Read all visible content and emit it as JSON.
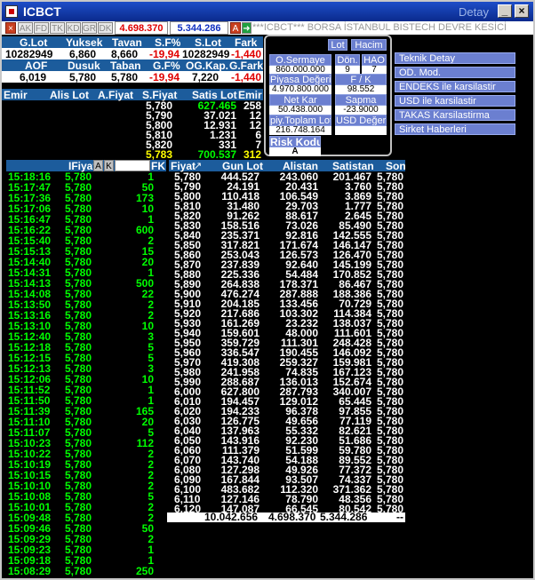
{
  "window": {
    "title": "ICBCT",
    "detay": "Detay"
  },
  "toolbar": {
    "buttons": [
      "AK",
      "FD",
      "TK",
      "KD",
      "GR",
      "DK"
    ],
    "price_red": "4.698.370",
    "price_blue": "5.344.286",
    "a_label": "A",
    "ticker": "***ICBCT*** BORSA İSTANBUL BISTECH DEVRE KESİCİ"
  },
  "stats": {
    "h1": [
      "G.Lot",
      "Yuksek",
      "Tavan",
      "S.F%",
      "S.Lot",
      "Fark"
    ],
    "r1": [
      "10282949",
      "6,860",
      "8,660",
      "-19,94",
      "10282949",
      "-1,440"
    ],
    "h2": [
      "AOF",
      "Dusuk",
      "Taban",
      "G.F%",
      "OG.Kap.",
      "G.Fark"
    ],
    "r2": [
      "6,019",
      "5,780",
      "5,780",
      "-19,94",
      "7,220",
      "-1,440"
    ]
  },
  "depth": {
    "headers": [
      "Emir",
      "Alis Lot",
      "A.Fiyat",
      "S.Fiyat",
      "Satis Lot",
      "Emir"
    ],
    "rows": [
      {
        "sf": "5,780",
        "sl": "627.465",
        "se": "258"
      },
      {
        "sf": "5,790",
        "sl": "37.021",
        "se": "12"
      },
      {
        "sf": "5,800",
        "sl": "12.931",
        "se": "12"
      },
      {
        "sf": "5,810",
        "sl": "1.231",
        "se": "6"
      },
      {
        "sf": "5,820",
        "sl": "331",
        "se": "7"
      },
      {
        "sf": "5,783",
        "sl": "700.537",
        "se": "312"
      }
    ]
  },
  "panel": {
    "lot": "Lot",
    "hacim": "Hacim",
    "osermaye": "O.Sermaye",
    "osermaye_val": "860.000.000",
    "don": "Dön.",
    "don_val": "9",
    "hao": "HAO",
    "hao_val": "7",
    "piyasa": "Piyasa Değeri",
    "piyasa_val": "4.970.800.000",
    "fk": "F / K",
    "fk_val": "98.552",
    "netkar": "Net Kar",
    "netkar_val": "50.438.000",
    "sapma": "Sapma",
    "sapma_val": "-23.9000",
    "piytoplam": "piy.Toplam Lot",
    "piytoplam_val": "216.748.164",
    "usd": "USD Değeri",
    "risk": "Risk Kodu",
    "risk_val": "A"
  },
  "menu": [
    "Teknik Detay",
    "OD. Mod.",
    "ENDEKS ile karsilastir",
    "USD ile karsilastir",
    "TAKAS Karsilastirma",
    "Sirket Haberleri"
  ],
  "trades": {
    "headers": {
      "fiyat": "IFiyat",
      "a": "A",
      "k": "K",
      "fk": "FK"
    },
    "rows": [
      [
        "15:18:16",
        "5,780",
        "1"
      ],
      [
        "15:17:47",
        "5,780",
        "50"
      ],
      [
        "15:17:36",
        "5,780",
        "173"
      ],
      [
        "15:17:06",
        "5,780",
        "10"
      ],
      [
        "15:16:47",
        "5,780",
        "1"
      ],
      [
        "15:16:22",
        "5,780",
        "600"
      ],
      [
        "15:15:40",
        "5,780",
        "2"
      ],
      [
        "15:15:13",
        "5,780",
        "15"
      ],
      [
        "15:14:40",
        "5,780",
        "20"
      ],
      [
        "15:14:31",
        "5,780",
        "1"
      ],
      [
        "15:14:13",
        "5,780",
        "500"
      ],
      [
        "15:14:08",
        "5,780",
        "22"
      ],
      [
        "15:13:50",
        "5,780",
        "2"
      ],
      [
        "15:13:16",
        "5,780",
        "2"
      ],
      [
        "15:13:10",
        "5,780",
        "10"
      ],
      [
        "15:12:40",
        "5,780",
        "3"
      ],
      [
        "15:12:18",
        "5,780",
        "5"
      ],
      [
        "15:12:15",
        "5,780",
        "5"
      ],
      [
        "15:12:13",
        "5,780",
        "3"
      ],
      [
        "15:12:06",
        "5,780",
        "10"
      ],
      [
        "15:11:52",
        "5,780",
        "1"
      ],
      [
        "15:11:50",
        "5,780",
        "1"
      ],
      [
        "15:11:39",
        "5,780",
        "165"
      ],
      [
        "15:11:10",
        "5,780",
        "20"
      ],
      [
        "15:11:07",
        "5,780",
        "5"
      ],
      [
        "15:10:23",
        "5,780",
        "112"
      ],
      [
        "15:10:22",
        "5,780",
        "2"
      ],
      [
        "15:10:19",
        "5,780",
        "2"
      ],
      [
        "15:10:15",
        "5,780",
        "2"
      ],
      [
        "15:10:10",
        "5,780",
        "2"
      ],
      [
        "15:10:08",
        "5,780",
        "5"
      ],
      [
        "15:10:01",
        "5,780",
        "2"
      ],
      [
        "15:09:48",
        "5,780",
        "2"
      ],
      [
        "15:09:46",
        "5,780",
        "50"
      ],
      [
        "15:09:29",
        "5,780",
        "2"
      ],
      [
        "15:09:23",
        "5,780",
        "1"
      ],
      [
        "15:09:18",
        "5,780",
        "1"
      ],
      [
        "15:08:29",
        "5,780",
        "250"
      ]
    ]
  },
  "prices": {
    "headers": [
      "Fiyat",
      "Gun Lot",
      "Alistan",
      "Satistan",
      "Son"
    ],
    "sort_icon": "sort-arrow-icon",
    "rows": [
      [
        "5,780",
        "444.527",
        "243.060",
        "201.467",
        "5,780"
      ],
      [
        "5,790",
        "24.191",
        "20.431",
        "3.760",
        "5,780"
      ],
      [
        "5,800",
        "110.418",
        "106.549",
        "3.869",
        "5,780"
      ],
      [
        "5,810",
        "31.480",
        "29.703",
        "1.777",
        "5,780"
      ],
      [
        "5,820",
        "91.262",
        "88.617",
        "2.645",
        "5,780"
      ],
      [
        "5,830",
        "158.516",
        "73.026",
        "85.490",
        "5,780"
      ],
      [
        "5,840",
        "235.371",
        "92.816",
        "142.555",
        "5,780"
      ],
      [
        "5,850",
        "317.821",
        "171.674",
        "146.147",
        "5,780"
      ],
      [
        "5,860",
        "253.043",
        "126.573",
        "126.470",
        "5,780"
      ],
      [
        "5,870",
        "237.839",
        "92.640",
        "145.199",
        "5,780"
      ],
      [
        "5,880",
        "225.336",
        "54.484",
        "170.852",
        "5,780"
      ],
      [
        "5,890",
        "264.838",
        "178.371",
        "86.467",
        "5,780"
      ],
      [
        "5,900",
        "476.274",
        "287.888",
        "188.386",
        "5,780"
      ],
      [
        "5,910",
        "204.185",
        "133.456",
        "70.729",
        "5,780"
      ],
      [
        "5,920",
        "217.686",
        "103.302",
        "114.384",
        "5,780"
      ],
      [
        "5,930",
        "161.269",
        "23.232",
        "138.037",
        "5,780"
      ],
      [
        "5,940",
        "159.601",
        "48.000",
        "111.601",
        "5,780"
      ],
      [
        "5,950",
        "359.729",
        "111.301",
        "248.428",
        "5,780"
      ],
      [
        "5,960",
        "336.547",
        "190.455",
        "146.092",
        "5,780"
      ],
      [
        "5,970",
        "419.308",
        "259.327",
        "159.981",
        "5,780"
      ],
      [
        "5,980",
        "241.958",
        "74.835",
        "167.123",
        "5,780"
      ],
      [
        "5,990",
        "288.687",
        "136.013",
        "152.674",
        "5,780"
      ],
      [
        "6,000",
        "627.800",
        "287.793",
        "340.007",
        "5,780"
      ],
      [
        "6,010",
        "194.457",
        "129.012",
        "65.445",
        "5,780"
      ],
      [
        "6,020",
        "194.233",
        "96.378",
        "97.855",
        "5,780"
      ],
      [
        "6,030",
        "126.775",
        "49.656",
        "77.119",
        "5,780"
      ],
      [
        "6,040",
        "137.963",
        "55.332",
        "82.621",
        "5,780"
      ],
      [
        "6,050",
        "143.916",
        "92.230",
        "51.686",
        "5,780"
      ],
      [
        "6,060",
        "111.379",
        "51.599",
        "59.780",
        "5,780"
      ],
      [
        "6,070",
        "143.740",
        "54.188",
        "89.552",
        "5,780"
      ],
      [
        "6,080",
        "127.298",
        "49.926",
        "77.372",
        "5,780"
      ],
      [
        "6,090",
        "167.844",
        "93.507",
        "74.337",
        "5,780"
      ],
      [
        "6,100",
        "483.682",
        "112.320",
        "371.362",
        "5,780"
      ],
      [
        "6,110",
        "127.146",
        "78.790",
        "48.356",
        "5,780"
      ],
      [
        "6,120",
        "147.087",
        "66.545",
        "80.542",
        "5,780"
      ]
    ],
    "totals": [
      "10.042.656",
      "4.698.370",
      "5.344.286",
      "--"
    ]
  }
}
